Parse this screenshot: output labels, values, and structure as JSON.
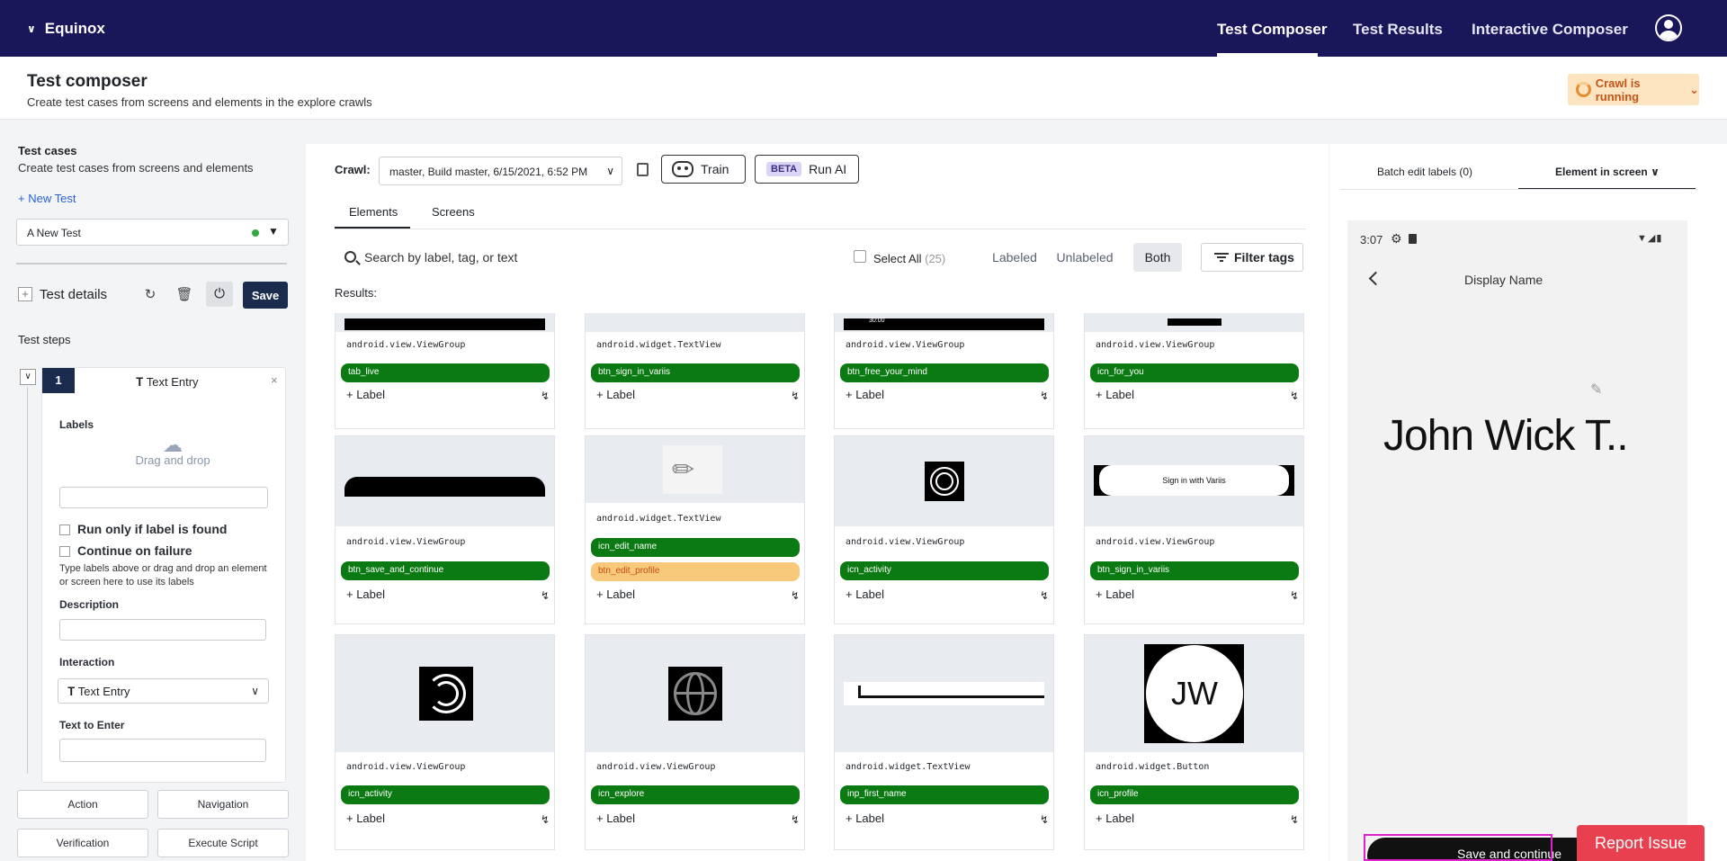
{
  "nav": {
    "brand": "Equinox",
    "links": [
      "Test Composer",
      "Test Results",
      "Interactive Composer"
    ]
  },
  "header": {
    "title": "Test composer",
    "subtitle": "Create test cases from screens and elements in the explore crawls",
    "crawl_status": "Crawl is running"
  },
  "left": {
    "title": "Test cases",
    "subtitle": "Create test cases from screens and elements",
    "new_test": "New Test",
    "selected_test": "A New Test",
    "test_details": "Test details",
    "save": "Save",
    "steps_title": "Test steps",
    "step": {
      "number": "1",
      "type": "Text Entry",
      "labels_title": "Labels",
      "drag_drop": "Drag and drop",
      "run_only": "Run only if label is found",
      "continue_fail": "Continue on failure",
      "help": "Type labels above or drag and drop an element or screen here to use its labels",
      "description": "Description",
      "interaction": "Interaction",
      "interaction_value": "Text Entry",
      "text_to_enter": "Text to Enter"
    },
    "buttons": [
      "Action",
      "Navigation",
      "Verification",
      "Execute Script"
    ]
  },
  "mid": {
    "crawl_label": "Crawl:",
    "crawl_value": "master, Build master, 6/15/2021, 6:52 PM",
    "train": "Train",
    "beta": "BETA",
    "run_ai": "Run AI",
    "tabs": [
      "Elements",
      "Screens"
    ],
    "search_placeholder": "Search by label, tag, or text",
    "select_all": "Select All",
    "select_count": "(25)",
    "segments": [
      "Labeled",
      "Unlabeled",
      "Both"
    ],
    "filter": "Filter tags",
    "results": "Results:",
    "add_label": "+ Label",
    "cards": [
      {
        "cls": "android.view.ViewGroup",
        "tags": [
          {
            "t": "tab_live",
            "c": "green"
          }
        ]
      },
      {
        "cls": "android.widget.TextView",
        "tags": [
          {
            "t": "btn_sign_in_variis",
            "c": "green"
          }
        ]
      },
      {
        "cls": "android.view.ViewGroup",
        "tags": [
          {
            "t": "btn_free_your_mind",
            "c": "green"
          }
        ]
      },
      {
        "cls": "android.view.ViewGroup",
        "tags": [
          {
            "t": "icn_for_you",
            "c": "green"
          }
        ]
      },
      {
        "cls": "android.view.ViewGroup",
        "tags": [
          {
            "t": "btn_save_and_continue",
            "c": "green"
          }
        ]
      },
      {
        "cls": "android.widget.TextView",
        "tags": [
          {
            "t": "icn_edit_name",
            "c": "green"
          },
          {
            "t": "btn_edit_profile",
            "c": "orange"
          }
        ]
      },
      {
        "cls": "android.view.ViewGroup",
        "tags": [
          {
            "t": "icn_activity",
            "c": "green"
          }
        ]
      },
      {
        "cls": "android.view.ViewGroup",
        "tags": [
          {
            "t": "btn_sign_in_variis",
            "c": "green"
          }
        ]
      },
      {
        "cls": "android.view.ViewGroup",
        "tags": [
          {
            "t": "icn_activity",
            "c": "green"
          }
        ]
      },
      {
        "cls": "android.view.ViewGroup",
        "tags": [
          {
            "t": "icn_explore",
            "c": "green"
          }
        ]
      },
      {
        "cls": "android.widget.TextView",
        "tags": [
          {
            "t": "inp_first_name",
            "c": "green"
          }
        ]
      },
      {
        "cls": "android.widget.Button",
        "tags": [
          {
            "t": "icn_profile",
            "c": "green"
          }
        ]
      }
    ],
    "thumb_texts": {
      "timer": "30:00",
      "signin": "Sign in with Variis",
      "initials": "JW"
    }
  },
  "right": {
    "tabs": [
      "Batch edit labels (0)",
      "Element in screen"
    ],
    "phone": {
      "time": "3:07",
      "title": "Display Name",
      "name": "John Wick T..",
      "save": "Save and continue"
    }
  },
  "report": "Report Issue"
}
